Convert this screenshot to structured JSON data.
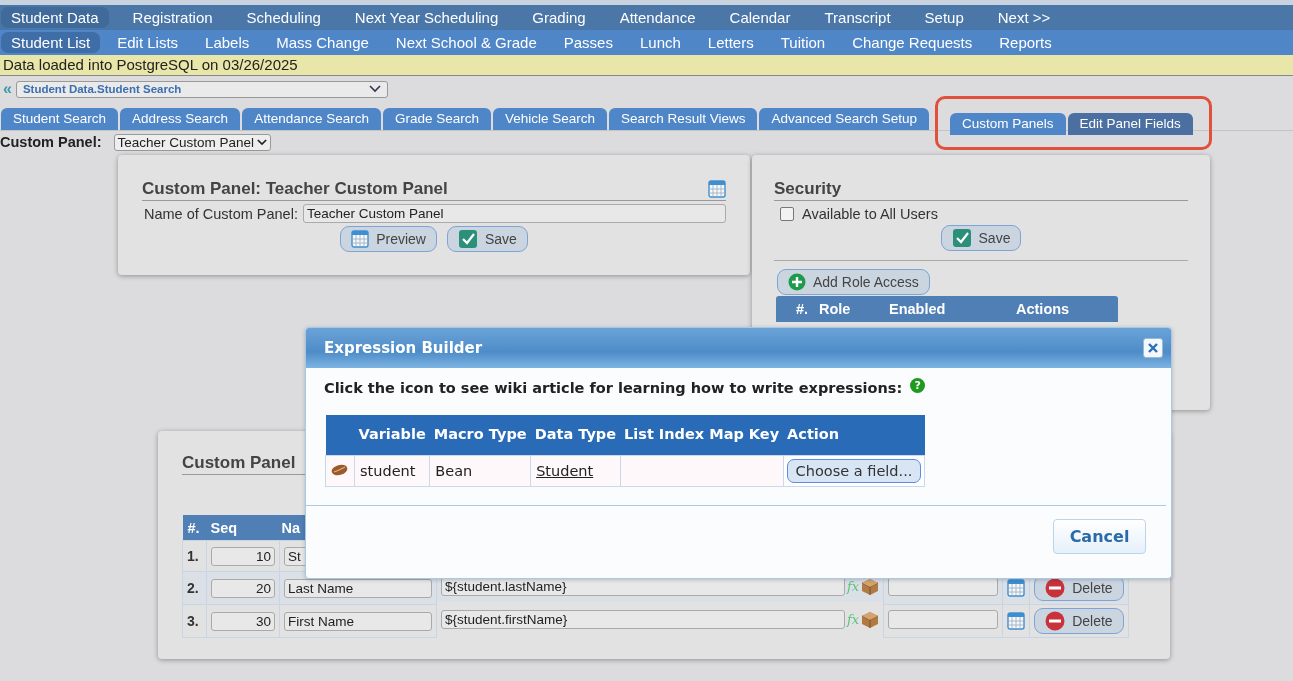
{
  "nav_primary": [
    {
      "label": "Student Data",
      "selected": true
    },
    {
      "label": "Registration",
      "selected": false
    },
    {
      "label": "Scheduling",
      "selected": false
    },
    {
      "label": "Next Year Scheduling",
      "selected": false
    },
    {
      "label": "Grading",
      "selected": false
    },
    {
      "label": "Attendance",
      "selected": false
    },
    {
      "label": "Calendar",
      "selected": false
    },
    {
      "label": "Transcript",
      "selected": false
    },
    {
      "label": "Setup",
      "selected": false
    },
    {
      "label": "Next >>",
      "selected": false
    }
  ],
  "nav_secondary": [
    {
      "label": "Student List",
      "selected": true
    },
    {
      "label": "Edit Lists",
      "selected": false
    },
    {
      "label": "Labels",
      "selected": false
    },
    {
      "label": "Mass Change",
      "selected": false
    },
    {
      "label": "Next School & Grade",
      "selected": false
    },
    {
      "label": "Passes",
      "selected": false
    },
    {
      "label": "Lunch",
      "selected": false
    },
    {
      "label": "Letters",
      "selected": false
    },
    {
      "label": "Tuition",
      "selected": false
    },
    {
      "label": "Change Requests",
      "selected": false
    },
    {
      "label": "Reports",
      "selected": false
    }
  ],
  "notice": "Data loaded into PostgreSQL on 03/26/2025",
  "view_select": {
    "collapse_glyph": "«",
    "value": "Student Data.Student Search"
  },
  "tabs": [
    {
      "label": "Student Search",
      "selected": false,
      "highlighted": false
    },
    {
      "label": "Address Search",
      "selected": false,
      "highlighted": false
    },
    {
      "label": "Attendance Search",
      "selected": false,
      "highlighted": false
    },
    {
      "label": "Grade Search",
      "selected": false,
      "highlighted": false
    },
    {
      "label": "Vehicle Search",
      "selected": false,
      "highlighted": false
    },
    {
      "label": "Search Result Views",
      "selected": false,
      "highlighted": false
    },
    {
      "label": "Advanced Search Setup",
      "selected": false,
      "highlighted": false
    },
    {
      "label": "Custom Panels",
      "selected": false,
      "highlighted": true
    },
    {
      "label": "Edit Panel Fields",
      "selected": true,
      "highlighted": true
    }
  ],
  "custom_panel_select": {
    "label": "Custom Panel:",
    "value": "Teacher Custom Panel"
  },
  "panel_editor": {
    "title": "Custom Panel: Teacher Custom Panel",
    "name_label": "Name of Custom Panel:",
    "name_value": "Teacher Custom Panel",
    "buttons": [
      {
        "label": "Preview",
        "kind": "preview"
      },
      {
        "label": "Save",
        "kind": "save"
      }
    ]
  },
  "security": {
    "title": "Security",
    "checkbox": {
      "label": "Available to All Users",
      "checked": false
    },
    "save_button": "Save",
    "add_button": "Add Role Access",
    "columns": [
      "#.",
      "Role",
      "Enabled",
      "Actions"
    ]
  },
  "fields_panel": {
    "title": "Custom Panel",
    "columns": [
      "#.",
      "Seq",
      "Na"
    ],
    "rows": [
      {
        "number": "1.",
        "seq": "10",
        "name": "St"
      },
      {
        "number": "2.",
        "seq": "20",
        "name": "Last Name",
        "expression": "${student.lastName}",
        "formula_glyph": "fx",
        "delete_button": "Delete"
      },
      {
        "number": "3.",
        "seq": "30",
        "name": "First Name",
        "expression": "${student.firstName}",
        "formula_glyph": "fx",
        "delete_button": "Delete"
      }
    ]
  },
  "dialog": {
    "title": "Expression Builder",
    "instructions": "Click the icon to see wiki article for learning how to write expressions:",
    "help_glyph": "?",
    "columns": [
      "Variable",
      "Macro Type",
      "Data Type",
      "List Index Map Key",
      "Action"
    ],
    "rows": [
      {
        "variable": "student",
        "macro_type": "Bean",
        "data_type": "Student",
        "list_index": "",
        "action_button": "Choose a field..."
      }
    ],
    "cancel_button": "Cancel"
  }
}
